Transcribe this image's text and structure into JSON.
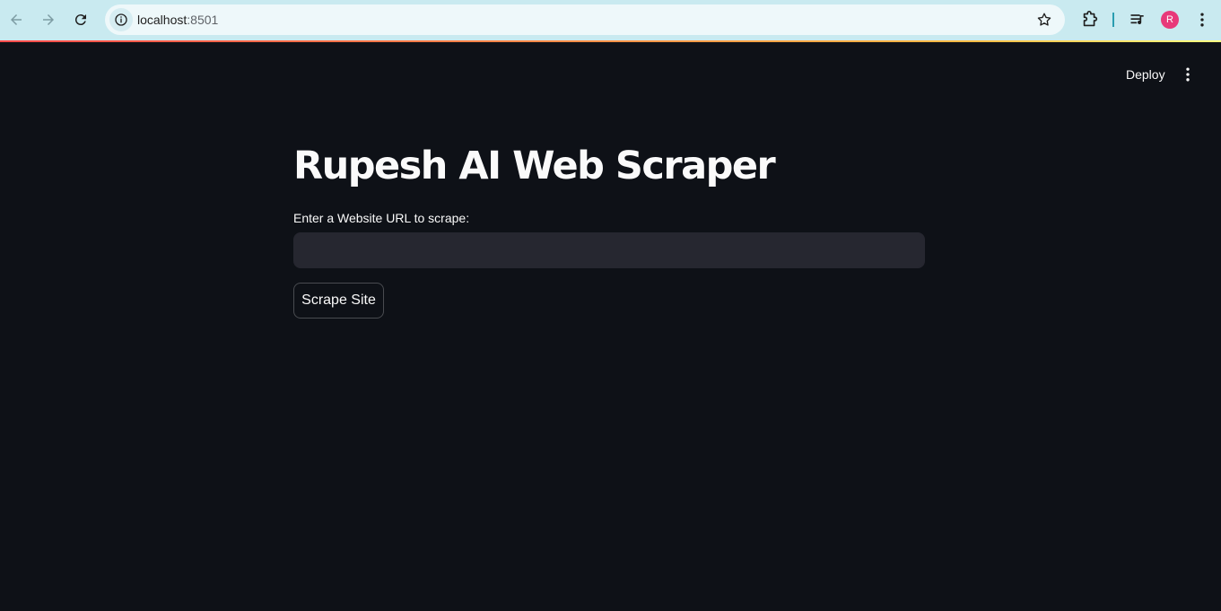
{
  "browser": {
    "url_host": "localhost",
    "url_port": ":8501",
    "profile_initial": "R",
    "icons": {
      "back": "arrow-left-icon",
      "forward": "arrow-right-icon",
      "reload": "reload-icon",
      "site_info": "info-icon",
      "bookmark": "star-icon",
      "extensions": "puzzle-icon",
      "media": "media-queue-icon",
      "menu": "kebab-menu-icon"
    },
    "colors": {
      "toolbar": "#c9eaf0",
      "omnibox": "#eef8fa",
      "avatar": "#e8397a"
    }
  },
  "app": {
    "deploy_label": "Deploy",
    "title": "Rupesh AI Web Scraper",
    "url_label": "Enter a Website URL to scrape:",
    "url_value": "",
    "scrape_button_label": "Scrape Site",
    "colors": {
      "background": "#0e1117",
      "input_background": "#262730",
      "text": "#fafafa"
    }
  }
}
